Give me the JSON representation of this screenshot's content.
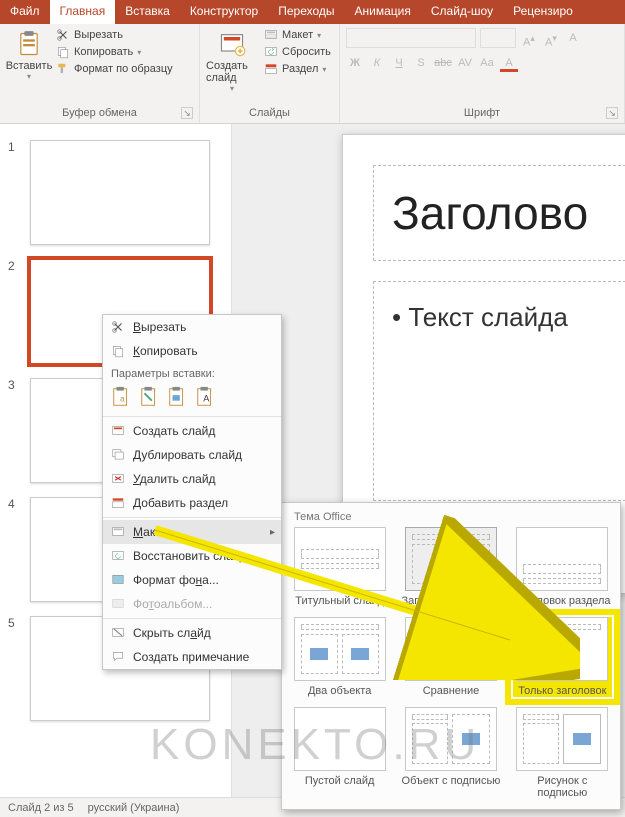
{
  "tabs": {
    "file": "Файл",
    "home": "Главная",
    "insert": "Вставка",
    "design": "Конструктор",
    "transitions": "Переходы",
    "animations": "Анимация",
    "slideshow": "Слайд-шоу",
    "review": "Рецензиро"
  },
  "ribbon": {
    "clipboard": {
      "paste": "Вставить",
      "cut": "Вырезать",
      "copy": "Копировать",
      "format_painter": "Формат по образцу",
      "group_label": "Буфер обмена"
    },
    "slides": {
      "new_slide": "Создать слайд",
      "layout": "Макет",
      "reset": "Сбросить",
      "section": "Раздел",
      "group_label": "Слайды"
    },
    "font": {
      "group_label": "Шрифт",
      "bold": "Ж",
      "italic": "К",
      "underline": "Ч",
      "shadow": "S",
      "strike": "abc",
      "spacing": "AV",
      "case": "Aa"
    }
  },
  "thumbs": {
    "n1": "1",
    "n2": "2",
    "n3": "3",
    "n4": "4",
    "n5": "5"
  },
  "slide": {
    "title": "Заголово",
    "body": "• Текст слайда"
  },
  "context_menu": {
    "cut": "Вырезать",
    "copy": "Копировать",
    "paste_options": "Параметры вставки:",
    "new_slide": "Создать слайд",
    "duplicate_slide": "Дублировать слайд",
    "delete_slide": "Удалить слайд",
    "add_section": "Добавить раздел",
    "layout": "Макет",
    "reset_slide": "Восстановить слайд",
    "format_background": "Формат фона...",
    "photo_album": "Фотоальбом...",
    "hide_slide": "Скрыть слайд",
    "new_comment": "Создать примечание"
  },
  "layout_flyout": {
    "theme": "Тема Office",
    "items": {
      "title_slide": "Титульный слайд",
      "title_content": "Заголовок и объект",
      "section_header": "Заголовок раздела",
      "two_content": "Два объекта",
      "comparison": "Сравнение",
      "title_only": "Только заголовок",
      "blank": "Пустой слайд",
      "content_caption": "Объект с подписью",
      "picture_caption": "Рисунок с подписью"
    }
  },
  "statusbar": {
    "slide_of": "Слайд 2 из 5",
    "language": "русский (Украина)"
  },
  "watermark": "KONEKTO.RU"
}
